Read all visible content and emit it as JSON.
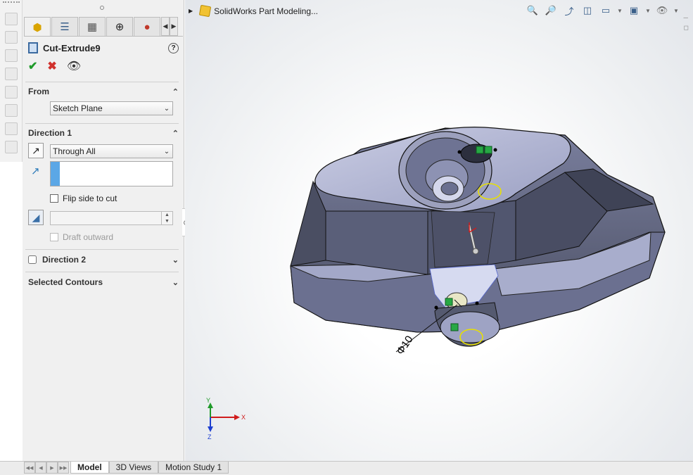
{
  "left_strip": {
    "tools": [
      "annotation-icon",
      "smart-dimension-icon",
      "note-icon",
      "balloon-icon",
      "weld-icon",
      "datum-icon",
      "geometric-tolerance-icon",
      "surface-finish-icon"
    ]
  },
  "panel": {
    "tabs": [
      "feature-manager-tab",
      "property-manager-tab",
      "configuration-manager-tab",
      "dimxpert-manager-tab",
      "display-manager-tab"
    ],
    "feature_title": "Cut-Extrude9",
    "help_label": "?",
    "from": {
      "header": "From",
      "selected": "Sketch Plane"
    },
    "direction1": {
      "header": "Direction 1",
      "end_condition": "Through All",
      "flip_side_label": "Flip side to cut",
      "draft_label": "Draft outward"
    },
    "direction2": {
      "header": "Direction 2"
    },
    "selected_contours": {
      "header": "Selected Contours"
    }
  },
  "viewport": {
    "tree_flyout_label": "SolidWorks Part Modeling...",
    "dimension_label": "Φ10",
    "triad": {
      "x": "X",
      "y": "Y",
      "z": "Z"
    },
    "colors": {
      "body": "#8f95b8",
      "body_dark": "#555a70",
      "face_highlight": "#d6daf0",
      "axis_x": "#d01c1c",
      "axis_y": "#1f9a2a",
      "axis_z": "#1d3fd0"
    }
  },
  "bottom_bar": {
    "tabs": [
      "Model",
      "3D Views",
      "Motion Study 1"
    ],
    "active": "Model"
  }
}
